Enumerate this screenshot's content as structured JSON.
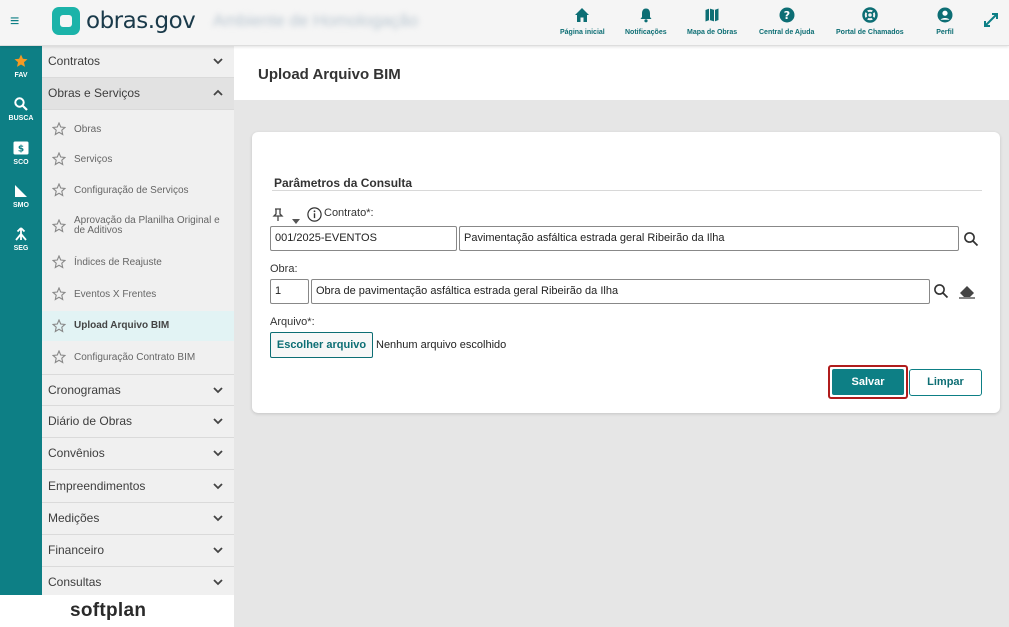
{
  "header": {
    "app_name": "obras.gov",
    "environment": "Ambiente de Homologação",
    "nav": [
      {
        "label": "Página inicial",
        "icon": "home-icon"
      },
      {
        "label": "Notificações",
        "icon": "bell-icon"
      },
      {
        "label": "Mapa de Obras",
        "icon": "map-icon"
      },
      {
        "label": "Central de Ajuda",
        "icon": "help-icon"
      },
      {
        "label": "Portal de Chamados",
        "icon": "lifebuoy-icon"
      },
      {
        "label": "Perfil",
        "icon": "profile-icon"
      }
    ]
  },
  "rail": [
    {
      "label": "FAV",
      "icon": "star-icon",
      "color": "#f59a23"
    },
    {
      "label": "BUSCA",
      "icon": "search-icon"
    },
    {
      "label": "SCO",
      "icon": "sco-icon"
    },
    {
      "label": "SMO",
      "icon": "smo-icon"
    },
    {
      "label": "SEG",
      "icon": "seg-icon"
    }
  ],
  "sidebar": {
    "categories": [
      {
        "label": "Contratos"
      },
      {
        "label": "Obras e Serviços"
      },
      {
        "label": "Cronogramas"
      },
      {
        "label": "Diário de Obras"
      },
      {
        "label": "Convênios"
      },
      {
        "label": "Empreendimentos"
      },
      {
        "label": "Medições"
      },
      {
        "label": "Financeiro"
      },
      {
        "label": "Consultas"
      }
    ],
    "sub_items": [
      {
        "label": "Obras"
      },
      {
        "label": "Serviços"
      },
      {
        "label": "Configuração de Serviços"
      },
      {
        "label": "Aprovação da Planilha Original e de Aditivos"
      },
      {
        "label": "Índices de Reajuste"
      },
      {
        "label": "Eventos X Frentes"
      },
      {
        "label": "Upload Arquivo BIM"
      },
      {
        "label": "Configuração Contrato BIM"
      }
    ],
    "footer_brand": "softplan"
  },
  "page": {
    "title": "Upload Arquivo BIM"
  },
  "form": {
    "section_title": "Parâmetros da Consulta",
    "contrato_label": "Contrato*:",
    "contrato_code": "001/2025-EVENTOS",
    "contrato_desc": "Pavimentação asfáltica estrada geral Ribeirão da Ilha",
    "obra_label": "Obra:",
    "obra_code": "1",
    "obra_desc": "Obra de pavimentação asfáltica estrada geral Ribeirão da Ilha",
    "arquivo_label": "Arquivo*:",
    "file_button": "Escolher arquivo",
    "file_status": "Nenhum arquivo escolhido",
    "save_label": "Salvar",
    "clear_label": "Limpar"
  },
  "colors": {
    "primary": "#0d7f85",
    "highlight_border": "#b01c1c",
    "favorite": "#f59a23"
  }
}
